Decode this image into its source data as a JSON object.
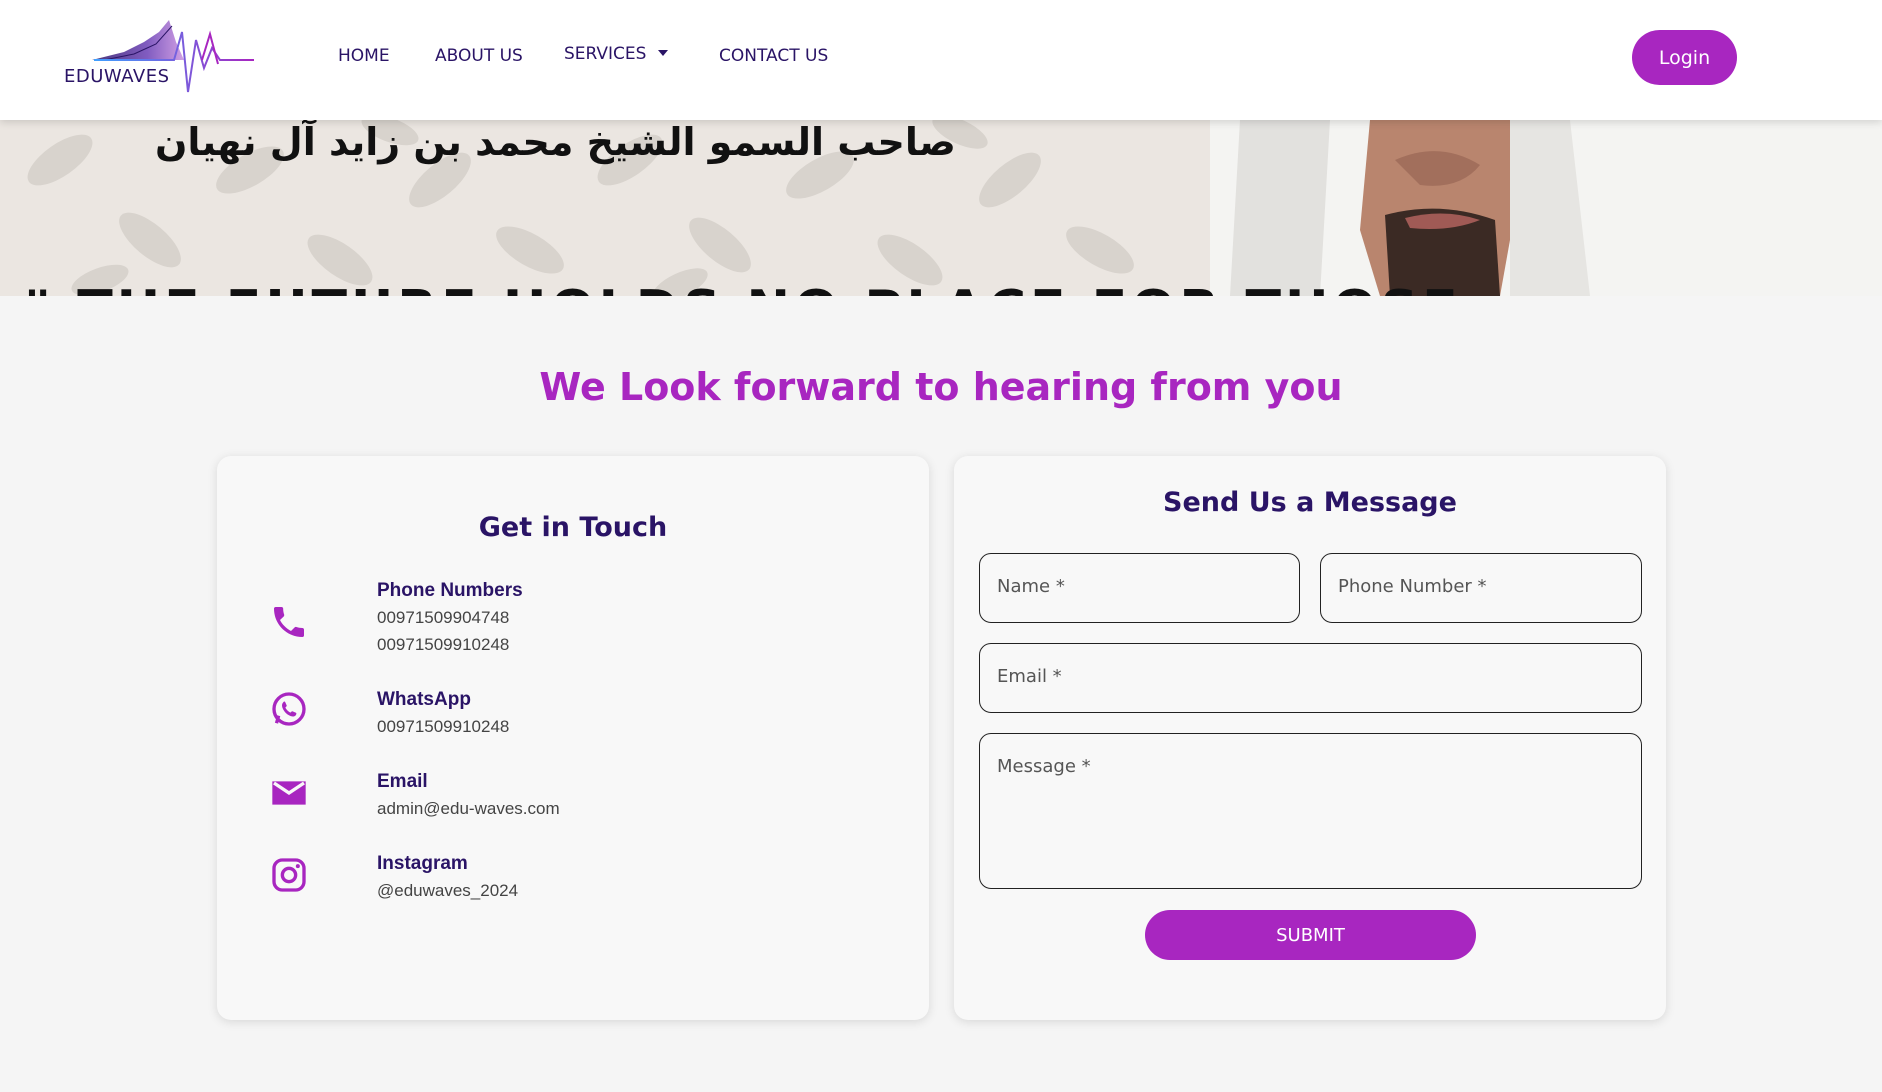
{
  "header": {
    "logo_text": "EDUWAVES",
    "nav": [
      {
        "label": "HOME"
      },
      {
        "label": "ABOUT US"
      },
      {
        "label": "SERVICES"
      },
      {
        "label": "CONTACT US"
      }
    ],
    "login_label": "Login"
  },
  "banner": {
    "arabic_text": "صاحب السمو الشيخ محمد بن زايد آل نهيان",
    "quote_partial": "\" THE FUTURE HOLDS NO PLACE FOR THOSE"
  },
  "main": {
    "heading": "We Look forward to hearing from you"
  },
  "contact": {
    "title": "Get in Touch",
    "items": [
      {
        "label": "Phone Numbers",
        "values": [
          "00971509904748",
          "00971509910248"
        ],
        "icon": "phone-icon"
      },
      {
        "label": "WhatsApp",
        "values": [
          "00971509910248"
        ],
        "icon": "whatsapp-icon"
      },
      {
        "label": "Email",
        "values": [
          "admin@edu-waves.com"
        ],
        "icon": "email-icon"
      },
      {
        "label": "Instagram",
        "values": [
          "@eduwaves_2024"
        ],
        "icon": "instagram-icon"
      }
    ]
  },
  "form": {
    "title": "Send Us a Message",
    "name_label": "Name *",
    "phone_label": "Phone Number *",
    "email_label": "Email *",
    "message_label": "Message *",
    "submit_label": "SUBMIT"
  },
  "colors": {
    "accent": "#a826c0",
    "navy": "#2a1466",
    "background": "#f5f5f5"
  }
}
